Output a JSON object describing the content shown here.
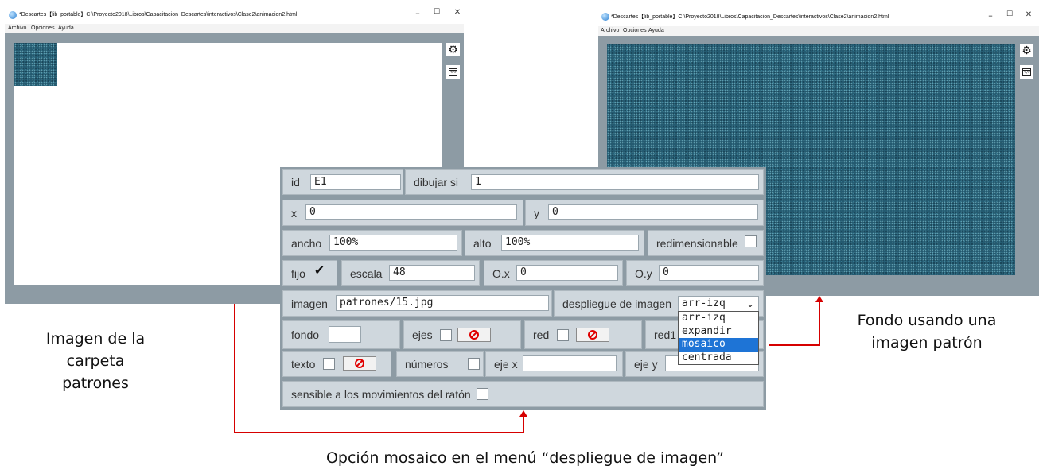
{
  "left_window": {
    "title": "*Descartes【lib_portable】C:\\Proyecto2018\\Libros\\Capacitacion_Descartes\\interactivos\\Clase2\\animacion2.html",
    "menu": [
      "Archivo",
      "Opciones",
      "Ayuda"
    ],
    "controls": {
      "minimize": "–",
      "maximize": "☐",
      "close": "✕"
    }
  },
  "right_window": {
    "title": "*Descartes【lib_portable】C:\\Proyecto2018\\Libros\\Capacitacion_Descartes\\interactivos\\Clase2\\animacion2.html",
    "menu": [
      "Archivo",
      "Opciones",
      "Ayuda"
    ],
    "controls": {
      "minimize": "–",
      "maximize": "☐",
      "close": "✕"
    }
  },
  "icons": {
    "config": "gear-icon",
    "code": "code-window-icon",
    "no": "prohibited-icon",
    "check": "checkmark"
  },
  "panel": {
    "id_label": "id",
    "id_value": "E1",
    "dibujar_si_label": "dibujar si",
    "dibujar_si_value": "1",
    "x_label": "x",
    "x_value": "0",
    "y_label": "y",
    "y_value": "0",
    "ancho_label": "ancho",
    "ancho_value": "100%",
    "alto_label": "alto",
    "alto_value": "100%",
    "redimensionable_label": "redimensionable",
    "fijo_label": "fijo",
    "fijo_check": "✔",
    "escala_label": "escala",
    "escala_value": "48",
    "ox_label": "O.x",
    "ox_value": "0",
    "oy_label": "O.y",
    "oy_value": "0",
    "imagen_label": "imagen",
    "imagen_value": "patrones/15.jpg",
    "despliegue_label": "despliegue de imagen",
    "despliegue_value": "arr-izq",
    "despliegue_options": [
      "arr-izq",
      "expandir",
      "mosaico",
      "centrada"
    ],
    "despliegue_highlighted": "mosaico",
    "fondo_label": "fondo",
    "ejes_label": "ejes",
    "red_label": "red",
    "red10_label": "red1",
    "texto_label": "texto",
    "numeros_label": "números",
    "ejex_label": "eje x",
    "ejey_label": "eje y",
    "sensible_label": "sensible a los movimientos del ratón"
  },
  "colors": {
    "window_gray": "#8d9ba4",
    "pattern_teal": "#245a70",
    "cell_bg": "#cfd7dd",
    "arrow_red": "#d60000",
    "highlight_blue": "#1e74d6"
  },
  "annotations": {
    "left_line1": "Imagen de la",
    "left_line2": "carpeta",
    "left_line3": "patrones",
    "right_line1": "Fondo usando una",
    "right_line2": "imagen patrón",
    "bottom": "Opción mosaico en el menú “despliegue de imagen”"
  }
}
